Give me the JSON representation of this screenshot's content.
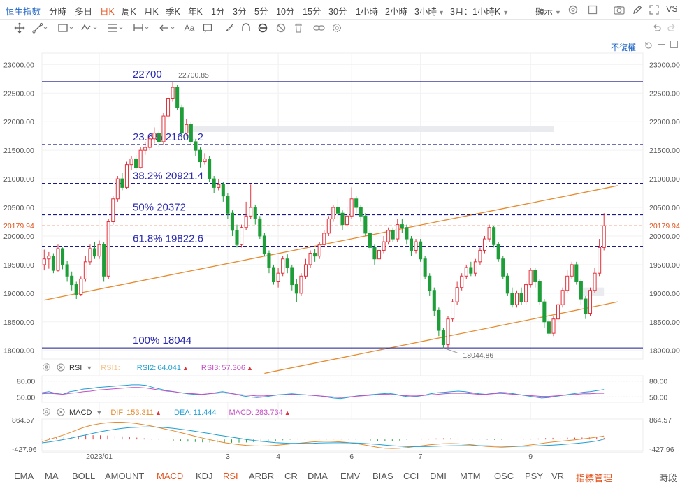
{
  "topbar": {
    "symbol": "恒生指數",
    "timeframes": [
      "分時",
      "多日",
      "日K",
      "周K",
      "月K",
      "季K",
      "年K",
      "1分",
      "3分",
      "5分",
      "10分",
      "15分",
      "30分",
      "1小時",
      "2小時",
      "3小時"
    ],
    "timeframe_more": "3小時",
    "timeframe_custom": "3月：1小時K",
    "active_timeframe": "日K",
    "display_label": "顯示",
    "vs_label": "VS"
  },
  "toolbar": {
    "text_tool": "Aa",
    "adjust_label": "不復權"
  },
  "price_axis": {
    "ticks": [
      "23000.00",
      "22500.00",
      "22000.00",
      "21500.00",
      "21000.00",
      "20500.00",
      "20000.00",
      "19500.00",
      "19000.00",
      "18500.00",
      "18000.00"
    ],
    "current_price": "20179.94"
  },
  "annotations": {
    "high_value": "22700.85",
    "low_value": "18044.86"
  },
  "fibonacci": [
    {
      "label": "22700",
      "value": 22700
    },
    {
      "label": "23.6% 21601.2",
      "value": 21601.2
    },
    {
      "label": "38.2% 20921.4",
      "value": 20921.4
    },
    {
      "label": "50% 20372",
      "value": 20372
    },
    {
      "label": "61.8% 19822.6",
      "value": 19822.6
    },
    {
      "label": "100% 18044",
      "value": 18044
    }
  ],
  "rsi": {
    "name": "RSI",
    "rsi1_label": "RSI1:",
    "rsi2_label": "RSI2:",
    "rsi2_value": "64.041",
    "rsi3_label": "RSI3:",
    "rsi3_value": "57.306",
    "axis": [
      "80.00",
      "50.00"
    ]
  },
  "macd": {
    "name": "MACD",
    "dif_label": "DIF:",
    "dif_value": "153.311",
    "dea_label": "DEA:",
    "dea_value": "11.444",
    "macd_label": "MACD:",
    "macd_value": "283.734",
    "axis": [
      "864.57",
      "-427.96"
    ]
  },
  "x_axis": {
    "labels": [
      "2023/01",
      "3",
      "4",
      "6",
      "7",
      "9"
    ]
  },
  "indicators": {
    "items": [
      "EMA",
      "MA",
      "BOLL",
      "AMOUNT",
      "MACD",
      "KDJ",
      "RSI",
      "ARBR",
      "CR",
      "DMA",
      "EMV",
      "BIAS",
      "CCI",
      "DMI",
      "MTM",
      "OSC",
      "PSY",
      "VR"
    ],
    "active": [
      "MACD",
      "RSI"
    ],
    "manage_label": "指標管理",
    "period_label": "時段"
  },
  "colors": {
    "up": "#e2323c",
    "down": "#1e9e38",
    "accent": "#e3541e",
    "fib_line": "#1a1a8c",
    "channel": "#e68a2e",
    "link": "#2166c5"
  },
  "chart_data": {
    "type": "candlestick",
    "ylim": [
      17850,
      23200
    ],
    "channel_lines": [
      {
        "from": [
          0,
          18880
        ],
        "to": [
          125,
          20880
        ]
      },
      {
        "from": [
          48,
          17600
        ],
        "to": [
          125,
          18850
        ]
      }
    ],
    "candles": [
      [
        19500,
        19600,
        19760,
        19400
      ],
      [
        19600,
        19650,
        19720,
        19430
      ],
      [
        19650,
        19400,
        19700,
        19350
      ],
      [
        19400,
        19780,
        19850,
        19380
      ],
      [
        19780,
        19500,
        19800,
        19420
      ],
      [
        19500,
        19300,
        19560,
        19200
      ],
      [
        19300,
        19150,
        19380,
        19050
      ],
      [
        19150,
        18980,
        19200,
        18900
      ],
      [
        18980,
        19250,
        19300,
        18950
      ],
      [
        19250,
        19550,
        19650,
        19200
      ],
      [
        19550,
        19780,
        19850,
        19500
      ],
      [
        19780,
        19650,
        19900,
        19600
      ],
      [
        19650,
        19850,
        19920,
        19600
      ],
      [
        19850,
        19300,
        19900,
        19200
      ],
      [
        19300,
        20250,
        20300,
        19250
      ],
      [
        20250,
        20650,
        20700,
        20200
      ],
      [
        20650,
        21000,
        21050,
        20600
      ],
      [
        21000,
        20850,
        21100,
        20800
      ],
      [
        20850,
        21250,
        21300,
        20820
      ],
      [
        21250,
        21350,
        21400,
        21150
      ],
      [
        21350,
        21200,
        21420,
        21150
      ],
      [
        21200,
        21500,
        21550,
        21180
      ],
      [
        21500,
        21550,
        21650,
        21420
      ],
      [
        21550,
        21700,
        21780,
        21500
      ],
      [
        21700,
        21800,
        21900,
        21620
      ],
      [
        21800,
        21650,
        21850,
        21550
      ],
      [
        21650,
        22100,
        22150,
        21600
      ],
      [
        22100,
        22400,
        22450,
        22050
      ],
      [
        22400,
        22600,
        22700,
        22350
      ],
      [
        22600,
        22250,
        22650,
        22200
      ],
      [
        22250,
        21800,
        22300,
        21700
      ],
      [
        21800,
        21950,
        22050,
        21750
      ],
      [
        21950,
        21650,
        22000,
        21600
      ],
      [
        21650,
        21500,
        21700,
        21400
      ],
      [
        21500,
        21300,
        21550,
        21200
      ],
      [
        21300,
        21350,
        21450,
        21250
      ],
      [
        21350,
        21000,
        21400,
        20950
      ],
      [
        21000,
        20850,
        21050,
        20750
      ],
      [
        20850,
        20900,
        21000,
        20800
      ],
      [
        20900,
        20700,
        20950,
        20600
      ],
      [
        20700,
        20400,
        20750,
        20300
      ],
      [
        20400,
        20100,
        20450,
        20000
      ],
      [
        20100,
        19850,
        20200,
        19800
      ],
      [
        19850,
        20150,
        20200,
        19800
      ],
      [
        20150,
        20350,
        20600,
        20100
      ],
      [
        20350,
        20500,
        20900,
        20300
      ],
      [
        20500,
        20300,
        20550,
        20200
      ],
      [
        20300,
        20000,
        20350,
        19950
      ],
      [
        20000,
        19700,
        20050,
        19650
      ],
      [
        19700,
        19450,
        19750,
        19350
      ],
      [
        19450,
        19200,
        19500,
        19150
      ],
      [
        19200,
        19350,
        19450,
        19100
      ],
      [
        19350,
        19600,
        19650,
        19300
      ],
      [
        19600,
        19450,
        19680,
        19350
      ],
      [
        19450,
        19150,
        19500,
        19050
      ],
      [
        19150,
        19000,
        19250,
        18850
      ],
      [
        19000,
        19300,
        19350,
        18950
      ],
      [
        19300,
        19500,
        19600,
        19250
      ],
      [
        19500,
        19700,
        19750,
        19450
      ],
      [
        19700,
        19650,
        19780,
        19550
      ],
      [
        19650,
        19850,
        19900,
        19600
      ],
      [
        19850,
        20050,
        20100,
        19800
      ],
      [
        20050,
        20300,
        20350,
        20000
      ],
      [
        20300,
        20500,
        20550,
        20250
      ],
      [
        20500,
        20400,
        20650,
        20300
      ],
      [
        20400,
        20200,
        20450,
        20100
      ],
      [
        20200,
        20350,
        20500,
        20150
      ],
      [
        20350,
        20650,
        20850,
        20300
      ],
      [
        20650,
        20500,
        20700,
        20400
      ],
      [
        20500,
        20350,
        20550,
        20250
      ],
      [
        20350,
        20050,
        20400,
        20000
      ],
      [
        20050,
        19800,
        20100,
        19750
      ],
      [
        19800,
        19600,
        19850,
        19500
      ],
      [
        19600,
        19750,
        19800,
        19550
      ],
      [
        19750,
        19900,
        20000,
        19700
      ],
      [
        19900,
        20100,
        20150,
        19850
      ],
      [
        20100,
        19950,
        20150,
        19900
      ],
      [
        19950,
        20200,
        20300,
        19900
      ],
      [
        20200,
        20150,
        20300,
        20050
      ],
      [
        20150,
        19950,
        20200,
        19850
      ],
      [
        19950,
        19750,
        20000,
        19650
      ],
      [
        19750,
        19900,
        19950,
        19700
      ],
      [
        19900,
        19600,
        19950,
        19550
      ],
      [
        19600,
        19300,
        19650,
        19250
      ],
      [
        19300,
        19050,
        19350,
        18950
      ],
      [
        19050,
        18700,
        19100,
        18600
      ],
      [
        18700,
        18350,
        18750,
        18250
      ],
      [
        18350,
        18100,
        18400,
        18044
      ],
      [
        18100,
        18550,
        18600,
        18050
      ],
      [
        18550,
        18850,
        18900,
        18500
      ],
      [
        18850,
        19100,
        19200,
        18800
      ],
      [
        19100,
        19300,
        19350,
        19050
      ],
      [
        19300,
        19450,
        19500,
        19250
      ],
      [
        19450,
        19350,
        19550,
        19300
      ],
      [
        19350,
        19550,
        19600,
        19300
      ],
      [
        19550,
        19750,
        19800,
        19500
      ],
      [
        19750,
        19950,
        20000,
        19700
      ],
      [
        19950,
        20150,
        20200,
        19900
      ],
      [
        20150,
        19850,
        20180,
        19800
      ],
      [
        19850,
        19600,
        19900,
        19550
      ],
      [
        19600,
        19300,
        19650,
        19250
      ],
      [
        19300,
        19000,
        19350,
        18950
      ],
      [
        19000,
        18800,
        19100,
        18750
      ],
      [
        18800,
        19000,
        19050,
        18750
      ],
      [
        19000,
        18850,
        19100,
        18800
      ],
      [
        18850,
        19150,
        19200,
        18800
      ],
      [
        19150,
        19400,
        19450,
        19100
      ],
      [
        19400,
        19200,
        19450,
        19100
      ],
      [
        19200,
        18850,
        19250,
        18800
      ],
      [
        18850,
        18500,
        18900,
        18400
      ],
      [
        18500,
        18300,
        18550,
        18250
      ],
      [
        18300,
        18550,
        18600,
        18250
      ],
      [
        18550,
        18800,
        18850,
        18500
      ],
      [
        18800,
        19050,
        19100,
        18750
      ],
      [
        19050,
        19300,
        19400,
        19000
      ],
      [
        19300,
        19500,
        19550,
        19250
      ],
      [
        19500,
        19200,
        19550,
        19150
      ],
      [
        19200,
        18900,
        19250,
        18800
      ],
      [
        18900,
        18650,
        18950,
        18550
      ],
      [
        18650,
        19050,
        19100,
        18600
      ],
      [
        19050,
        19350,
        19450,
        19000
      ],
      [
        19350,
        19800,
        19950,
        19300
      ],
      [
        19800,
        20179.94,
        20400,
        19750
      ]
    ],
    "x_tick_index": [
      12,
      40,
      51,
      67,
      82,
      106
    ],
    "rsi_ylim": [
      40,
      90
    ],
    "rsi_series": [
      {
        "name": "RSI2",
        "color": "#1f9fd3",
        "values": [
          58,
          60,
          57,
          55,
          60,
          62,
          65,
          66,
          68,
          69,
          70,
          71,
          72,
          73,
          73,
          72,
          68,
          65,
          62,
          60,
          58,
          56,
          55,
          54,
          56,
          58,
          60,
          58,
          55,
          52,
          50,
          49,
          50,
          52,
          54,
          55,
          56,
          55,
          54,
          53,
          52,
          50,
          48,
          47,
          49,
          51,
          53,
          54,
          55,
          56,
          57,
          55,
          52,
          50,
          51,
          53,
          56,
          58,
          59,
          60,
          61,
          60,
          58,
          56,
          55,
          57,
          59,
          58,
          56,
          54,
          52,
          50,
          48,
          49,
          51,
          53,
          55,
          57,
          59,
          60,
          62,
          64
        ]
      },
      {
        "name": "RSI3",
        "color": "#c54fc5",
        "values": [
          56,
          57,
          56,
          55,
          57,
          58,
          60,
          61,
          63,
          64,
          65,
          66,
          67,
          68,
          68,
          67,
          65,
          63,
          61,
          60,
          58,
          57,
          56,
          55,
          56,
          57,
          58,
          57,
          55,
          54,
          53,
          52,
          52,
          53,
          54,
          54,
          55,
          54,
          54,
          53,
          52,
          51,
          50,
          49,
          50,
          51,
          52,
          53,
          54,
          55,
          55,
          54,
          53,
          52,
          52,
          53,
          54,
          55,
          56,
          57,
          57,
          57,
          56,
          55,
          55,
          56,
          57,
          56,
          55,
          54,
          53,
          52,
          51,
          51,
          52,
          53,
          54,
          55,
          56,
          56,
          57,
          57
        ]
      }
    ],
    "macd_ylim": [
      -520,
      900
    ],
    "macd_dif": [
      -100,
      0,
      100,
      200,
      320,
      450,
      560,
      640,
      700,
      740,
      760,
      760,
      740,
      700,
      650,
      590,
      520,
      450,
      380,
      300,
      220,
      140,
      60,
      -10,
      -80,
      -140,
      -190,
      -230,
      -260,
      -280,
      -290,
      -280,
      -260,
      -230,
      -200,
      -170,
      -140,
      -110,
      -90,
      -80,
      -90,
      -110,
      -140,
      -180,
      -230,
      -290,
      -350,
      -390,
      -400,
      -390,
      -360,
      -320,
      -280,
      -240,
      -210,
      -190,
      -180,
      -190,
      -210,
      -240,
      -280,
      -310,
      -330,
      -340,
      -330,
      -310,
      -280,
      -240,
      -200,
      -150,
      -110,
      -80,
      -50,
      -20,
      20,
      60,
      100,
      153
    ],
    "macd_dea": [
      -150,
      -110,
      -60,
      0,
      60,
      130,
      200,
      270,
      340,
      400,
      450,
      490,
      520,
      540,
      550,
      550,
      540,
      520,
      490,
      450,
      410,
      360,
      310,
      260,
      200,
      150,
      100,
      50,
      0,
      -40,
      -80,
      -110,
      -140,
      -160,
      -170,
      -175,
      -175,
      -170,
      -160,
      -150,
      -145,
      -145,
      -150,
      -160,
      -175,
      -195,
      -220,
      -250,
      -275,
      -295,
      -310,
      -315,
      -315,
      -310,
      -300,
      -290,
      -280,
      -275,
      -272,
      -272,
      -275,
      -280,
      -287,
      -295,
      -300,
      -302,
      -300,
      -293,
      -283,
      -268,
      -250,
      -230,
      -205,
      -180,
      -150,
      -115,
      -70,
      11
    ]
  }
}
